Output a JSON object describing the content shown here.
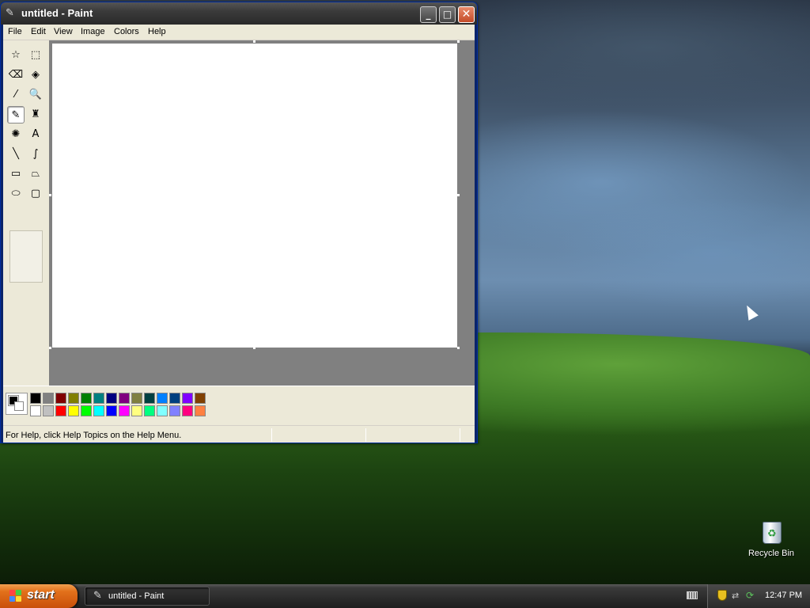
{
  "window": {
    "title": "untitled - Paint",
    "minimize": "_",
    "maximize": "□",
    "close": "✕"
  },
  "menu": [
    "File",
    "Edit",
    "View",
    "Image",
    "Colors",
    "Help"
  ],
  "tools": [
    {
      "name": "free-form-select",
      "glyph": "☆"
    },
    {
      "name": "select",
      "glyph": "⬚"
    },
    {
      "name": "eraser",
      "glyph": "⌫"
    },
    {
      "name": "fill-with-color",
      "glyph": "◈"
    },
    {
      "name": "pick-color",
      "glyph": "⁄"
    },
    {
      "name": "magnifier",
      "glyph": "🔍"
    },
    {
      "name": "pencil",
      "glyph": "✎"
    },
    {
      "name": "brush",
      "glyph": "♜"
    },
    {
      "name": "airbrush",
      "glyph": "✺"
    },
    {
      "name": "text",
      "glyph": "A"
    },
    {
      "name": "line",
      "glyph": "╲"
    },
    {
      "name": "curve",
      "glyph": "∫"
    },
    {
      "name": "rectangle",
      "glyph": "▭"
    },
    {
      "name": "polygon",
      "glyph": "⏢"
    },
    {
      "name": "ellipse",
      "glyph": "⬭"
    },
    {
      "name": "rounded-rectangle",
      "glyph": "▢"
    }
  ],
  "active_tool": "pencil",
  "palette": {
    "row1": [
      "#000000",
      "#808080",
      "#800000",
      "#808000",
      "#008000",
      "#008080",
      "#000080",
      "#800080",
      "#808040",
      "#004040",
      "#0080ff",
      "#004080",
      "#8000ff",
      "#804000"
    ],
    "row2": [
      "#ffffff",
      "#c0c0c0",
      "#ff0000",
      "#ffff00",
      "#00ff00",
      "#00ffff",
      "#0000ff",
      "#ff00ff",
      "#ffff80",
      "#00ff80",
      "#80ffff",
      "#8080ff",
      "#ff0080",
      "#ff8040"
    ],
    "foreground": "#000000",
    "background": "#ffffff"
  },
  "status": {
    "help_text": "For Help, click Help Topics on the Help Menu."
  },
  "desktop": {
    "recycle_bin_label": "Recycle Bin"
  },
  "taskbar": {
    "start_label": "start",
    "task_paint_label": "untitled - Paint",
    "clock": "12:47 PM"
  }
}
